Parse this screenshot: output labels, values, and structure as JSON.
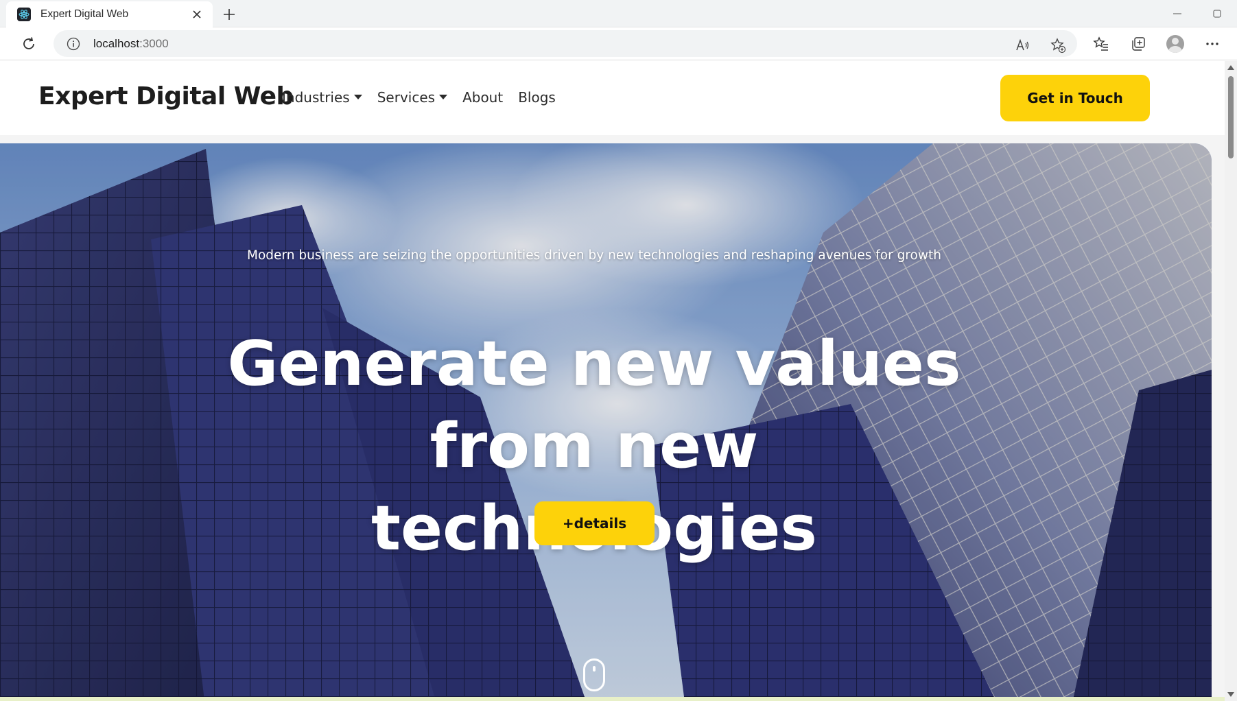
{
  "browser": {
    "tab_title": "Expert Digital Web",
    "url_host": "localhost",
    "url_port": ":3000",
    "icons": [
      "react-favicon-icon",
      "close-icon",
      "plus-icon",
      "minimize-icon",
      "restore-icon",
      "reload-icon",
      "info-icon",
      "read-aloud-icon",
      "add-favorite-icon",
      "favorites-icon",
      "collections-icon",
      "profile-avatar",
      "more-icon"
    ]
  },
  "site": {
    "logo": "Expert Digital Web",
    "nav": {
      "industries": "Industries",
      "services": "Services",
      "about": "About",
      "blogs": "Blogs"
    },
    "cta": "Get in Touch",
    "accent_color": "#fdd20a"
  },
  "hero": {
    "subtitle": "Modern business are seizing the opportunities driven by new technologies and reshaping avenues for growth",
    "title_line1": "Generate new values",
    "title_line2": "from new",
    "title_line3": "technologies",
    "button": "+details",
    "scroll_icon": "mouse-scroll-icon"
  }
}
